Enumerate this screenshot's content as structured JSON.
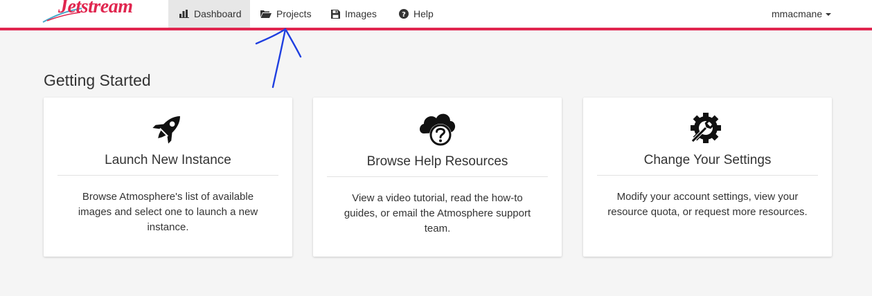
{
  "brand": {
    "name": "Jetstream",
    "color": "#e0264f"
  },
  "nav": {
    "items": [
      {
        "label": "Dashboard",
        "icon": "bar-chart-icon",
        "active": true
      },
      {
        "label": "Projects",
        "icon": "folder-open-icon",
        "active": false
      },
      {
        "label": "Images",
        "icon": "floppy-disk-icon",
        "active": false
      },
      {
        "label": "Help",
        "icon": "question-circle-icon",
        "active": false
      }
    ],
    "user": {
      "name": "mmacmane",
      "icon": "caret-down-icon"
    }
  },
  "annotation": {
    "type": "hand-drawn-arrow",
    "points_to": "Projects",
    "color": "#1f3fe0"
  },
  "main": {
    "title": "Getting Started",
    "cards": [
      {
        "icon": "rocket-icon",
        "title": "Launch New Instance",
        "description": "Browse Atmosphere's list of available images and select one to launch a new instance."
      },
      {
        "icon": "cloud-question-icon",
        "title": "Browse Help Resources",
        "description": "View a video tutorial, read the how-to guides, or email the Atmosphere support team."
      },
      {
        "icon": "gear-wrench-icon",
        "title": "Change Your Settings",
        "description": "Modify your account settings, view your resource quota, or request more resources."
      }
    ]
  }
}
